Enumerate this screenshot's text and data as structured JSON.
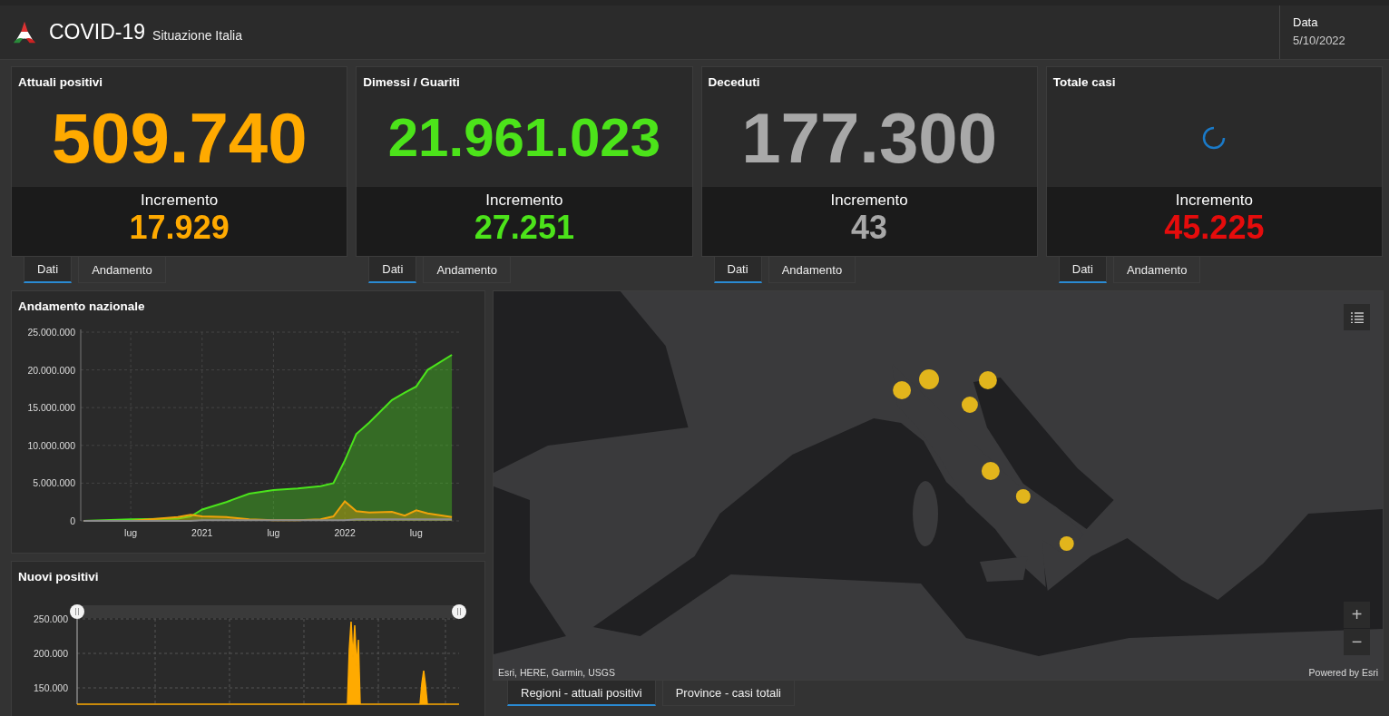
{
  "header": {
    "title": "COVID-19",
    "subtitle": "Situazione Italia",
    "date_label": "Data",
    "date_value": "5/10/2022"
  },
  "cards": [
    {
      "title": "Attuali positivi",
      "value": "509.740",
      "color": "#ffaa00",
      "loading": false,
      "increment_label": "Incremento",
      "increment": "17.929",
      "tabs": [
        {
          "label": "Dati",
          "selected": true
        },
        {
          "label": "Andamento",
          "selected": false
        }
      ]
    },
    {
      "title": "Dimessi / Guariti",
      "value": "21.961.023",
      "color": "#4ce31a",
      "loading": false,
      "increment_label": "Incremento",
      "increment": "27.251",
      "tabs": [
        {
          "label": "Dati",
          "selected": true
        },
        {
          "label": "Andamento",
          "selected": false
        }
      ]
    },
    {
      "title": "Deceduti",
      "value": "177.300",
      "color": "#a8a8a8",
      "loading": false,
      "increment_label": "Incremento",
      "increment": "43",
      "tabs": [
        {
          "label": "Dati",
          "selected": true
        },
        {
          "label": "Andamento",
          "selected": false
        }
      ]
    },
    {
      "title": "Totale casi",
      "color": "#e50c0c",
      "loading": true,
      "increment_label": "Incremento",
      "increment": "45.225",
      "tabs": [
        {
          "label": "Dati",
          "selected": true
        },
        {
          "label": "Andamento",
          "selected": false
        }
      ]
    }
  ],
  "trend_panel": {
    "title": "Andamento nazionale",
    "chart_data": {
      "type": "area",
      "x": [
        2020.17,
        2020.5,
        2020.83,
        2020.92,
        2021,
        2021.17,
        2021.33,
        2021.5,
        2021.67,
        2021.83,
        2021.92,
        2022,
        2022.08,
        2022.17,
        2022.33,
        2022.42,
        2022.5,
        2022.58,
        2022.75
      ],
      "series": [
        {
          "color": "#4be41c",
          "values": [
            0,
            200000,
            300000,
            600000,
            1500000,
            2500000,
            3600000,
            4100000,
            4300000,
            4600000,
            5000000,
            8000000,
            11500000,
            13000000,
            16000000,
            17000000,
            17800000,
            20000000,
            22000000
          ]
        },
        {
          "color": "#f0a30a",
          "values": [
            0,
            0,
            500000,
            800000,
            600000,
            500000,
            200000,
            100000,
            100000,
            200000,
            600000,
            2600000,
            1300000,
            1100000,
            1200000,
            700000,
            1400000,
            1000000,
            500000
          ]
        },
        {
          "color": "#8c8c8c",
          "values": [
            0,
            0,
            0,
            0,
            100000,
            100000,
            100000,
            100000,
            100000,
            100000,
            100000,
            100000,
            200000,
            200000,
            200000,
            200000,
            200000,
            200000,
            200000
          ]
        }
      ],
      "xlim": [
        2020.15,
        2022.8
      ],
      "ylim": [
        0,
        25000000
      ],
      "grid": true,
      "xticks": [
        {
          "value": 2020.5,
          "label": "lug"
        },
        {
          "value": 2021,
          "label": "2021"
        },
        {
          "value": 2021.5,
          "label": "lug"
        },
        {
          "value": 2022,
          "label": "2022"
        },
        {
          "value": 2022.5,
          "label": "lug"
        }
      ],
      "yticks": [
        {
          "value": 0,
          "label": "0"
        },
        {
          "value": 5000000,
          "label": "5.000.000"
        },
        {
          "value": 10000000,
          "label": "10.000.000"
        },
        {
          "value": 15000000,
          "label": "15.000.000"
        },
        {
          "value": 20000000,
          "label": "20.000.000"
        },
        {
          "value": 25000000,
          "label": "25.000.000"
        }
      ]
    }
  },
  "new_cases_panel": {
    "title": "Nuovi positivi",
    "axis_labels": [
      "250.000",
      "200.000",
      "150.000"
    ],
    "slider_handles": [
      {
        "level": 0
      },
      {
        "level": 1
      }
    ]
  },
  "map": {
    "attribution": "Esri, HERE, Garmin, USGS",
    "powered_by": "Powered by Esri",
    "zoom_in": "+",
    "zoom_out": "−",
    "tabs": [
      {
        "label": "Regioni - attuali positivi",
        "selected": true
      },
      {
        "label": "Province - casi totali",
        "selected": false
      }
    ]
  }
}
